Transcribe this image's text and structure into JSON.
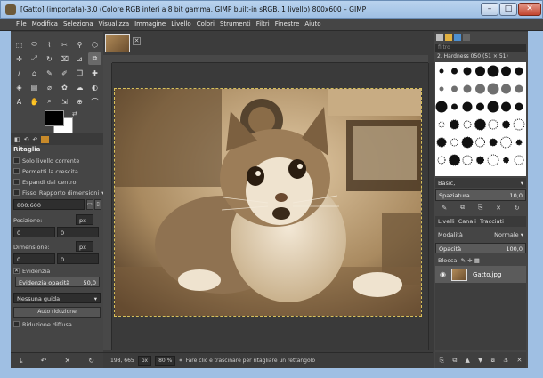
{
  "window": {
    "title": "[Gatto] (importata)-3.0 (Colore RGB interi a 8 bit gamma, GIMP built-in sRGB, 1 livello) 800x600 – GIMP",
    "min": "–",
    "max": "□",
    "close": "✕"
  },
  "menu": [
    "File",
    "Modifica",
    "Seleziona",
    "Visualizza",
    "Immagine",
    "Livello",
    "Colori",
    "Strumenti",
    "Filtri",
    "Finestre",
    "Aiuto"
  ],
  "toolbox": {
    "tool_glyphs": [
      "⬚",
      "⬭",
      "⌇",
      "✂",
      "⚲",
      "⬡",
      "✛",
      "⤢",
      "↻",
      "⌧",
      "⊿",
      "⧉",
      "∕",
      "⌂",
      "✎",
      "✐",
      "❒",
      "✚",
      "◈",
      "▤",
      "⌀",
      "✿",
      "☁",
      "◐",
      "A",
      "✋",
      "⌕",
      "⇲",
      "⊕",
      "⌒"
    ],
    "tabs_glyphs": [
      "◧",
      "⟲",
      "↶"
    ],
    "options_title": "Ritaglia",
    "opt_current_layer": "Solo livello corrente",
    "opt_allow_growing": "Permetti la crescita",
    "opt_expand_center": "Espandi dal centro",
    "fixed_label": "Fisso",
    "fixed_value": "Rapporto dimensioni",
    "ratio_value": "800:600",
    "position_label": "Posizione:",
    "position_unit": "px",
    "position_x": "0",
    "position_y": "0",
    "size_label": "Dimensione:",
    "size_unit": "px",
    "size_w": "0",
    "size_h": "0",
    "highlight_label": "Evidenzia",
    "highlight_opacity_label": "Evidenzia opacità",
    "highlight_opacity_value": "50,0",
    "guides_value": "Nessuna guida",
    "auto_shrink": "Auto riduzione",
    "shrink_merged": "Riduzione diffusa",
    "bottom_glyphs": [
      "⤓",
      "↶",
      "✕",
      "↻"
    ]
  },
  "image": {
    "close_glyph": "✕"
  },
  "status": {
    "coords": "198, 665",
    "unit": "px",
    "zoom": "80 %",
    "message": "Fare clic e trascinare per ritagliare un rettangolo"
  },
  "dock": {
    "filter_placeholder": "filtro",
    "brush_name": "2. Hardness 050 (51 × 51)",
    "preset_label": "Basic,",
    "spacing_label": "Spaziatura",
    "spacing_value": "10,0",
    "brush_button_glyphs": [
      "✎",
      "⧉",
      "⎘",
      "✕",
      "↻"
    ],
    "tab_layers": "Livelli",
    "tab_channels": "Canali",
    "tab_paths": "Tracciati",
    "mode_label": "Modalità",
    "mode_value": "Normale",
    "opacity_label": "Opacità",
    "opacity_value": "100,0",
    "lock_label": "Blocca:",
    "layer_name": "Gatto.jpg",
    "bottom_glyphs": [
      "⎘",
      "⧉",
      "▲",
      "▼",
      "⧇",
      "⚓",
      "✕"
    ]
  },
  "colors": {
    "photo_light": "#d9c09a",
    "photo_mid": "#a68559",
    "photo_dark": "#3e2b18",
    "cat_white": "#efe3cf"
  }
}
